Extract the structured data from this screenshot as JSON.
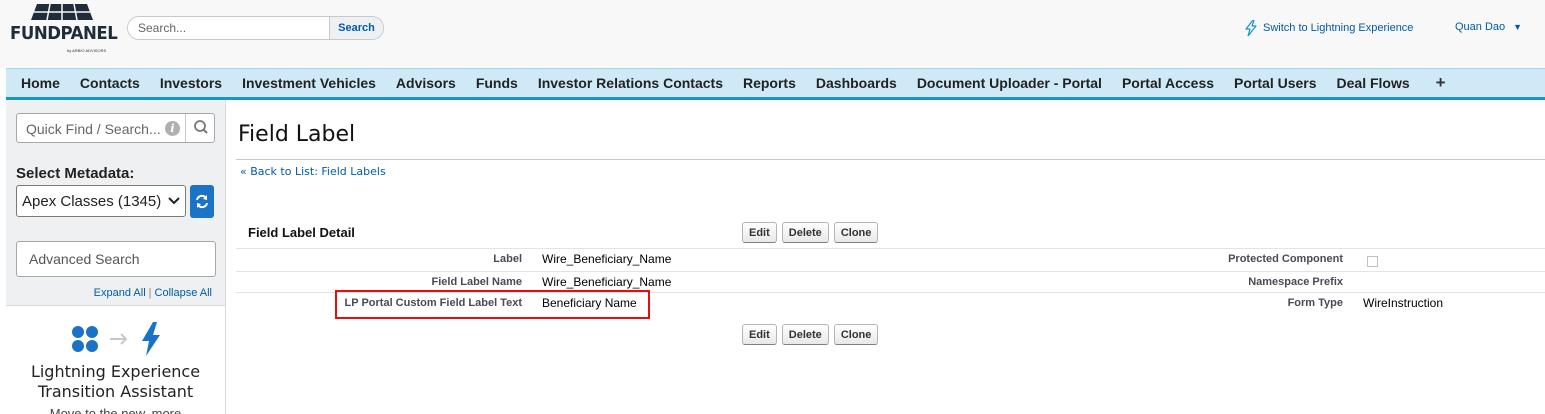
{
  "brand": {
    "logo_text": "FUNDPANEL",
    "logo_subtext": "by ARBIO ADVISORS"
  },
  "header": {
    "search_placeholder": "Search...",
    "search_button": "Search",
    "lightning_link": "Switch to Lightning Experience",
    "user_name": "Quan Dao"
  },
  "tabs": [
    "Home",
    "Contacts",
    "Investors",
    "Investment Vehicles",
    "Advisors",
    "Funds",
    "Investor Relations Contacts",
    "Reports",
    "Dashboards",
    "Document Uploader - Portal",
    "Portal Access",
    "Portal Users",
    "Deal Flows"
  ],
  "tab_plus": "+",
  "sidebar": {
    "quick_find_placeholder": "Quick Find / Search...",
    "select_metadata_label": "Select Metadata:",
    "selected_metadata": "Apex Classes (1345)",
    "advanced_search": "Advanced Search",
    "expand_all": "Expand All",
    "collapse_all": "Collapse All",
    "separator": "|",
    "lex_title_line1": "Lightning Experience",
    "lex_title_line2": "Transition Assistant",
    "lex_subtitle": "Move to the new, more"
  },
  "main": {
    "page_title": "Field Label",
    "back_link": "« Back to List: Field Labels",
    "section_title": "Field Label Detail",
    "buttons": {
      "edit": "Edit",
      "delete": "Delete",
      "clone": "Clone"
    },
    "fields": {
      "label_label": "Label",
      "label_value": "Wire_Beneficiary_Name",
      "field_label_name_label": "Field Label Name",
      "field_label_name_value": "Wire_Beneficiary_Name",
      "lp_portal_label": "LP Portal Custom Field Label Text",
      "lp_portal_value": "Beneficiary Name",
      "protected_component_label": "Protected Component",
      "protected_component_checked": false,
      "namespace_prefix_label": "Namespace Prefix",
      "namespace_prefix_value": "",
      "form_type_label": "Form Type",
      "form_type_value": "WireInstruction"
    }
  },
  "colors": {
    "link": "#015ba7",
    "tab_bar": "#cfeaf6",
    "tab_accent": "#1797c0",
    "highlight": "#e01010",
    "lex_blue": "#1b73c7"
  }
}
